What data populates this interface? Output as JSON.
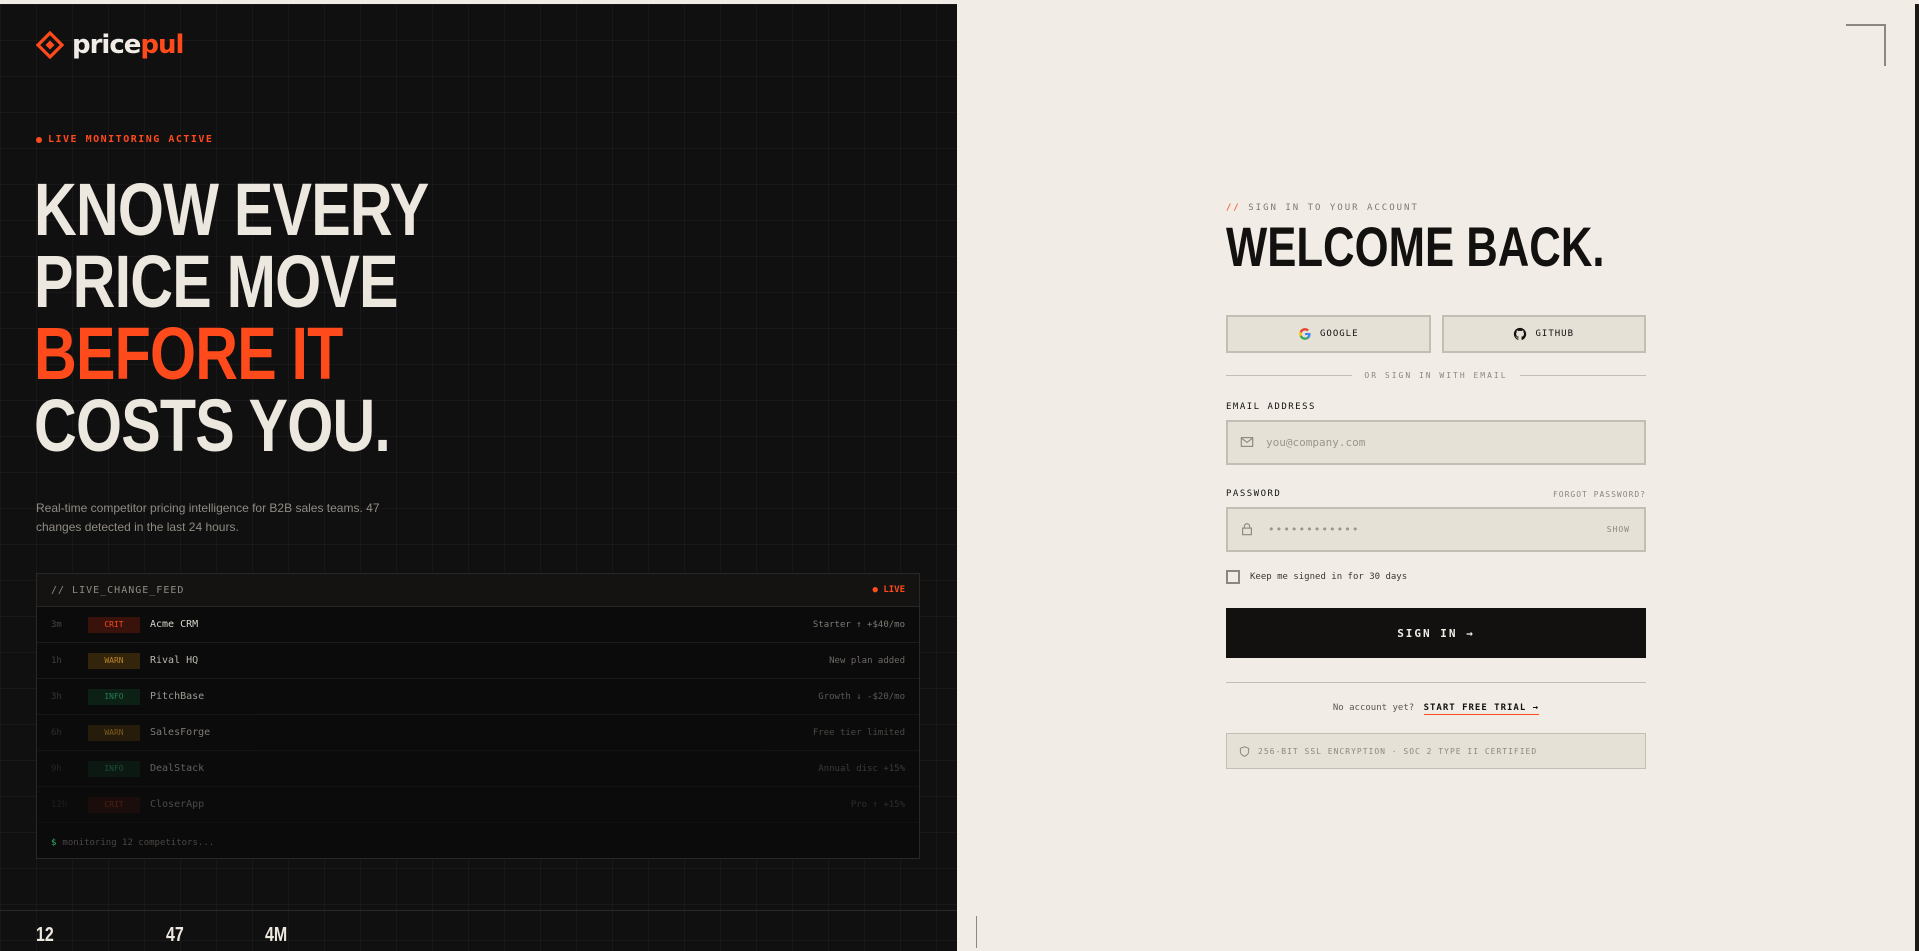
{
  "brand": {
    "name_main": "price",
    "name_accent": "pul",
    "accent_color": "#ff4a1c",
    "logo_icon": "diamond-logo-icon"
  },
  "hero": {
    "status_tag": "LIVE MONITORING ACTIVE",
    "headline": [
      "KNOW EVERY",
      "PRICE MOVE",
      "BEFORE IT",
      "COSTS YOU."
    ],
    "subcopy": "Real-time competitor pricing intelligence for B2B sales teams. 47 changes detected in the last 24 hours."
  },
  "feed": {
    "title": "// LIVE_CHANGE_FEED",
    "live_label": "● LIVE",
    "rows": [
      {
        "time": "3m",
        "level": "CRIT",
        "name": "Acme CRM",
        "change": "Starter ↑ +$40/mo",
        "opacity": 1.0
      },
      {
        "time": "1h",
        "level": "WARN",
        "name": "Rival HQ",
        "change": "New plan added",
        "opacity": 0.85
      },
      {
        "time": "3h",
        "level": "INFO",
        "name": "PitchBase",
        "change": "Growth ↓ -$20/mo",
        "opacity": 0.7
      },
      {
        "time": "6h",
        "level": "WARN",
        "name": "SalesForge",
        "change": "Free tier limited",
        "opacity": 0.55
      },
      {
        "time": "9h",
        "level": "INFO",
        "name": "DealStack",
        "change": "Annual disc +15%",
        "opacity": 0.42
      },
      {
        "time": "12h",
        "level": "CRIT",
        "name": "CloserApp",
        "change": "Pro ↑ +15%",
        "opacity": 0.3
      }
    ],
    "footer_prompt": "$",
    "footer_text": "monitoring 12 competitors..."
  },
  "stats": [
    "12",
    "47",
    "4M"
  ],
  "login": {
    "overline_slash": "//",
    "overline_text": "SIGN IN TO YOUR ACCOUNT",
    "title": "WELCOME BACK.",
    "google_label": "GOOGLE",
    "github_label": "GITHUB",
    "divider_text": "OR SIGN IN WITH EMAIL",
    "email_label": "EMAIL ADDRESS",
    "email_placeholder": "you@company.com",
    "password_label": "PASSWORD",
    "forgot_label": "FORGOT PASSWORD?",
    "password_mask": "••••••••••••",
    "show_label": "SHOW",
    "remember_label": "Keep me signed in for 30 days",
    "submit_label": "SIGN IN →",
    "no_account_text": "No account yet?",
    "trial_label": "START FREE TRIAL →",
    "security_text": "256-BIT SSL ENCRYPTION · SOC 2 TYPE II CERTIFIED"
  }
}
